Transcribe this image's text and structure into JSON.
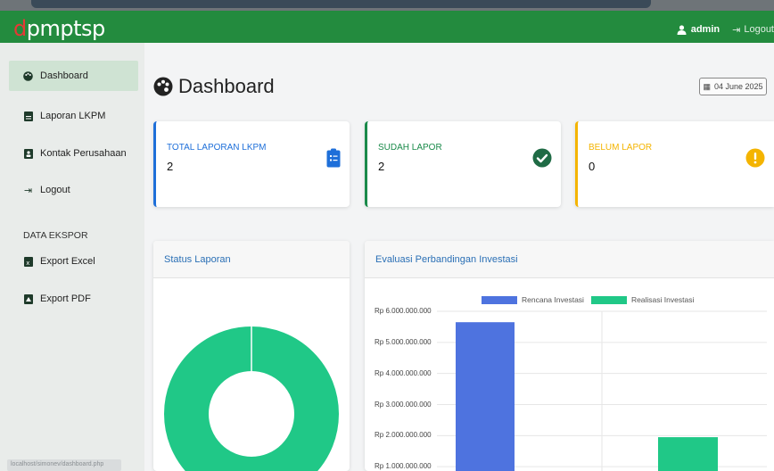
{
  "brand": {
    "first_letter": "d",
    "rest": "pmptsp"
  },
  "topbar": {
    "user": "admin",
    "logout": "Logout"
  },
  "sidebar": {
    "items": [
      {
        "label": "Dashboard",
        "icon": "palette-icon"
      },
      {
        "label": "Laporan LKPM",
        "icon": "file-icon"
      },
      {
        "label": "Kontak Perusahaan",
        "icon": "address-book-icon"
      },
      {
        "label": "Logout",
        "icon": "sign-out-icon"
      }
    ],
    "export_heading": "DATA EKSPOR",
    "export_items": [
      {
        "label": "Export Excel",
        "icon": "file-excel-icon"
      },
      {
        "label": "Export PDF",
        "icon": "file-pdf-icon"
      }
    ]
  },
  "status_url": "localhost/simonev/dashboard.php",
  "page": {
    "title": "Dashboard",
    "date": "04 June 2025"
  },
  "cards": [
    {
      "label": "TOTAL LAPORAN LKPM",
      "value": "2",
      "color": "#1e6fd9",
      "icon": "clipboard-list-icon"
    },
    {
      "label": "SUDAH LAPOR",
      "value": "2",
      "color": "#1a8a4a",
      "icon": "check-circle-icon"
    },
    {
      "label": "BELUM LAPOR",
      "value": "0",
      "color": "#f4b400",
      "icon": "exclamation-circle-icon"
    }
  ],
  "panels": {
    "status": "Status Laporan",
    "evaluasi": "Evaluasi Perbandingan Investasi"
  },
  "chart_data": [
    {
      "type": "pie",
      "title": "Status Laporan",
      "labels": [],
      "values": [
        2,
        0
      ],
      "colors": [
        "#20c887",
        "#f4b400"
      ]
    },
    {
      "type": "bar",
      "title": "Evaluasi Perbandingan Investasi",
      "series": [
        {
          "name": "Rencana Investasi",
          "color": "#4e73df",
          "values": [
            5650000000,
            0
          ]
        },
        {
          "name": "Realisasi Investasi",
          "color": "#20c887",
          "values": [
            0,
            1950000000
          ]
        }
      ],
      "ylim": [
        0,
        6000000000
      ],
      "ytick_labels": [
        "Rp 6.000.000.000",
        "Rp 5.000.000.000",
        "Rp 4.000.000.000",
        "Rp 3.000.000.000",
        "Rp 2.000.000.000",
        "Rp 1.000.000.000"
      ],
      "grid": true,
      "legend_placement": "top"
    }
  ]
}
